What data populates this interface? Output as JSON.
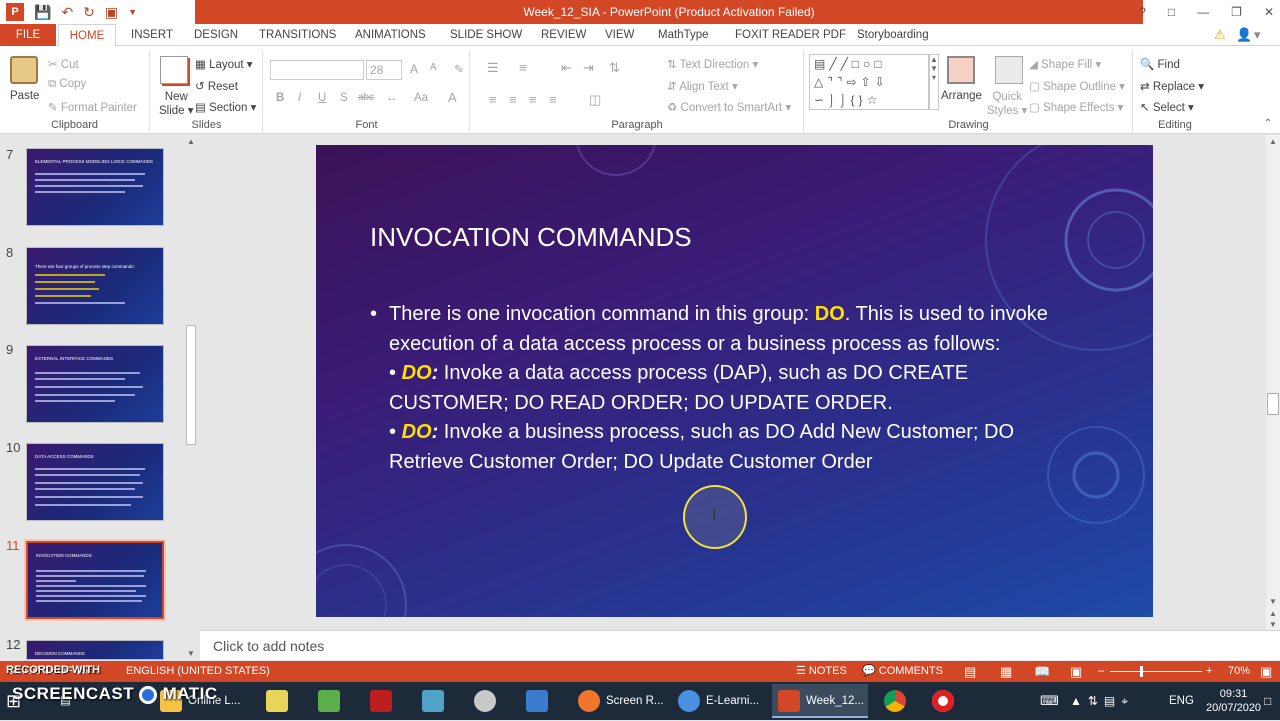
{
  "window": {
    "title": "Week_12_SIA  -  PowerPoint (Product Activation Failed)",
    "help": "?"
  },
  "tabs": [
    "FILE",
    "HOME",
    "INSERT",
    "DESIGN",
    "TRANSITIONS",
    "ANIMATIONS",
    "SLIDE SHOW",
    "REVIEW",
    "VIEW",
    "MathType",
    "FOXIT READER PDF",
    "Storyboarding"
  ],
  "ribbon": {
    "clipboard": {
      "label": "Clipboard",
      "paste": "Paste",
      "cut": "Cut",
      "copy": "Copy",
      "format_painter": "Format Painter"
    },
    "slides": {
      "label": "Slides",
      "new_slide_1": "New",
      "new_slide_2": "Slide",
      "layout": "Layout",
      "reset": "Reset",
      "section": "Section"
    },
    "font": {
      "label": "Font",
      "size": "28",
      "bold": "B",
      "italic": "I",
      "underline": "U",
      "strike": "S",
      "abc": "abc",
      "aa": "Aa",
      "a": "A"
    },
    "paragraph": {
      "label": "Paragraph",
      "text_direction": "Text Direction",
      "align_text": "Align Text",
      "convert_smartart": "Convert to SmartArt"
    },
    "drawing": {
      "label": "Drawing",
      "arrange": "Arrange",
      "quick_styles_1": "Quick",
      "quick_styles_2": "Styles",
      "shape_fill": "Shape Fill",
      "shape_outline": "Shape Outline",
      "shape_effects": "Shape Effects"
    },
    "editing": {
      "label": "Editing",
      "find": "Find",
      "replace": "Replace",
      "select": "Select"
    }
  },
  "thumbnails": [
    {
      "num": "7",
      "title": "ELEMENTAL PROCESS MODELING LOGIC COMMANDS"
    },
    {
      "num": "8",
      "title": "There are four groups of process step commands:"
    },
    {
      "num": "9",
      "title": "EXTERNAL INTERFACE COMMANDS"
    },
    {
      "num": "10",
      "title": "DATA ACCESS COMMANDS"
    },
    {
      "num": "11",
      "title": "INVOCATION COMMANDS"
    },
    {
      "num": "12",
      "title": "DECISION COMMANDS"
    }
  ],
  "slide": {
    "title": "INVOCATION COMMANDS",
    "bullet": "•",
    "p1_a": "There is one invocation command in this group: ",
    "p1_do": "DO",
    "p1_b": ". This is used to invoke execution of a data access process or a business process as follows:",
    "p2_bullet": "• ",
    "p2_do": "DO",
    "p2_colon": ":",
    "p2_text": " Invoke a data access process (DAP), such as DO CREATE CUSTOMER; DO READ ORDER; DO UPDATE ORDER.",
    "p3_bullet": "• ",
    "p3_do": "DO",
    "p3_colon": ":",
    "p3_text": " Invoke a business process, such as DO Add New Customer; DO Retrieve Customer Order; DO Update Customer Order"
  },
  "notes_placeholder": "Click to add notes",
  "status": {
    "slide_info": "SLIDE 11 OF 25",
    "language": "ENGLISH (UNITED STATES)",
    "notes": "NOTES",
    "comments": "COMMENTS",
    "zoom": "70%"
  },
  "watermark": {
    "line1": "RECORDED WITH",
    "line2": "SCREENCAST",
    "line3": "MATIC"
  },
  "taskbar": {
    "items": [
      "Online L...",
      "Screen R...",
      "E-Learni...",
      "Week_12..."
    ],
    "lang": "ENG",
    "time": "09:31",
    "date": "20/07/2020"
  },
  "colors": {
    "accent": "#d24726",
    "slide_highlight": "#ffe000"
  }
}
